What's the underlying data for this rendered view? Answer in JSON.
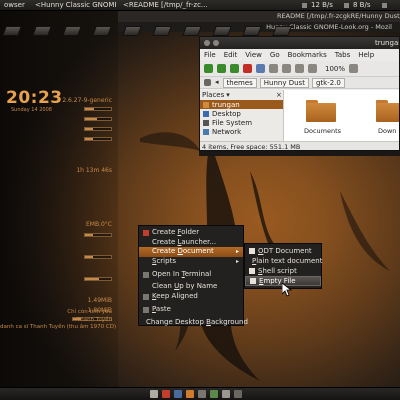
{
  "top_panel": {
    "tasks": [
      "owser",
      "<Hunny Classic GNOME...",
      "<README [/tmp/_fr-zc..."
    ],
    "net_down": "12 B/s",
    "net_up": "8 B/s"
  },
  "window_title_1": "README [/tmp/.fr-zcgkRE/Hunny Dust/gtk-",
  "window_title_2": "Hunny Classic GNOME-Look.org - Mozil",
  "conky": {
    "kernel": "2.6.27-9-generic",
    "uptime": "1h 13m 46s",
    "time": "20:23",
    "date": "Sunday 14 2008",
    "temp": "EMB.0°C",
    "mem_1": "1.49MiB",
    "mem_2": "1.80MiB",
    "credit_1": "Chỉ còn tình yêu",
    "credit_2": "Thanh Tuyền",
    "credit_3": "danh ca sĩ Thanh Tuyền (thu âm 1970 CD)",
    "bars": [
      0.35,
      0.45,
      0.3,
      0.3,
      0.3,
      0.3,
      0.55,
      0.2
    ]
  },
  "file_manager": {
    "title": "trungan - File",
    "menu": [
      "File",
      "Edit",
      "View",
      "Go",
      "Bookmarks",
      "Tabs",
      "Help"
    ],
    "breadcrumbs": [
      "themes",
      "Hunny Dust",
      "gtk-2.0"
    ],
    "zoom": "100%",
    "places_label": "Places",
    "places": [
      {
        "label": "trungan",
        "selected": true
      },
      {
        "label": "Desktop",
        "selected": false
      },
      {
        "label": "File System",
        "selected": false
      },
      {
        "label": "Network",
        "selected": false
      }
    ],
    "items": [
      "Documents",
      "Down"
    ],
    "status": "4 items, Free space: 551.1 MB"
  },
  "context_menu": {
    "items": [
      {
        "pre": "Create ",
        "u": "F",
        "post": "older",
        "icon": true
      },
      {
        "pre": "Create ",
        "u": "L",
        "post": "auncher...",
        "icon": false
      },
      {
        "pre": "Create ",
        "u": "D",
        "post": "ocument",
        "icon": false,
        "submenu": true,
        "active": true
      },
      {
        "pre": "",
        "u": "S",
        "post": "cripts",
        "icon": false,
        "submenu": true
      },
      {
        "sep": true
      },
      {
        "pre": "Open In ",
        "u": "T",
        "post": "erminal",
        "icon": true
      },
      {
        "sep": true
      },
      {
        "pre": "Clean ",
        "u": "U",
        "post": "p by Name",
        "icon": false
      },
      {
        "pre": "",
        "u": "K",
        "post": "eep Aligned",
        "icon": true
      },
      {
        "sep": true
      },
      {
        "pre": "",
        "u": "P",
        "post": "aste",
        "icon": true
      },
      {
        "sep": true
      },
      {
        "pre": "Change Desktop ",
        "u": "B",
        "post": "ackground",
        "icon": false
      }
    ]
  },
  "submenu": {
    "items": [
      {
        "pre": "",
        "u": "O",
        "post": "DT Document"
      },
      {
        "pre": "",
        "u": "P",
        "post": "lain text document"
      },
      {
        "pre": "",
        "u": "S",
        "post": "hell script"
      },
      {
        "pre": "",
        "u": "E",
        "post": "mpty File",
        "active": true
      }
    ]
  },
  "colors": {
    "accent": "#9a5a1c",
    "conky_text": "#c68a48",
    "menu_bg": "#232120"
  }
}
